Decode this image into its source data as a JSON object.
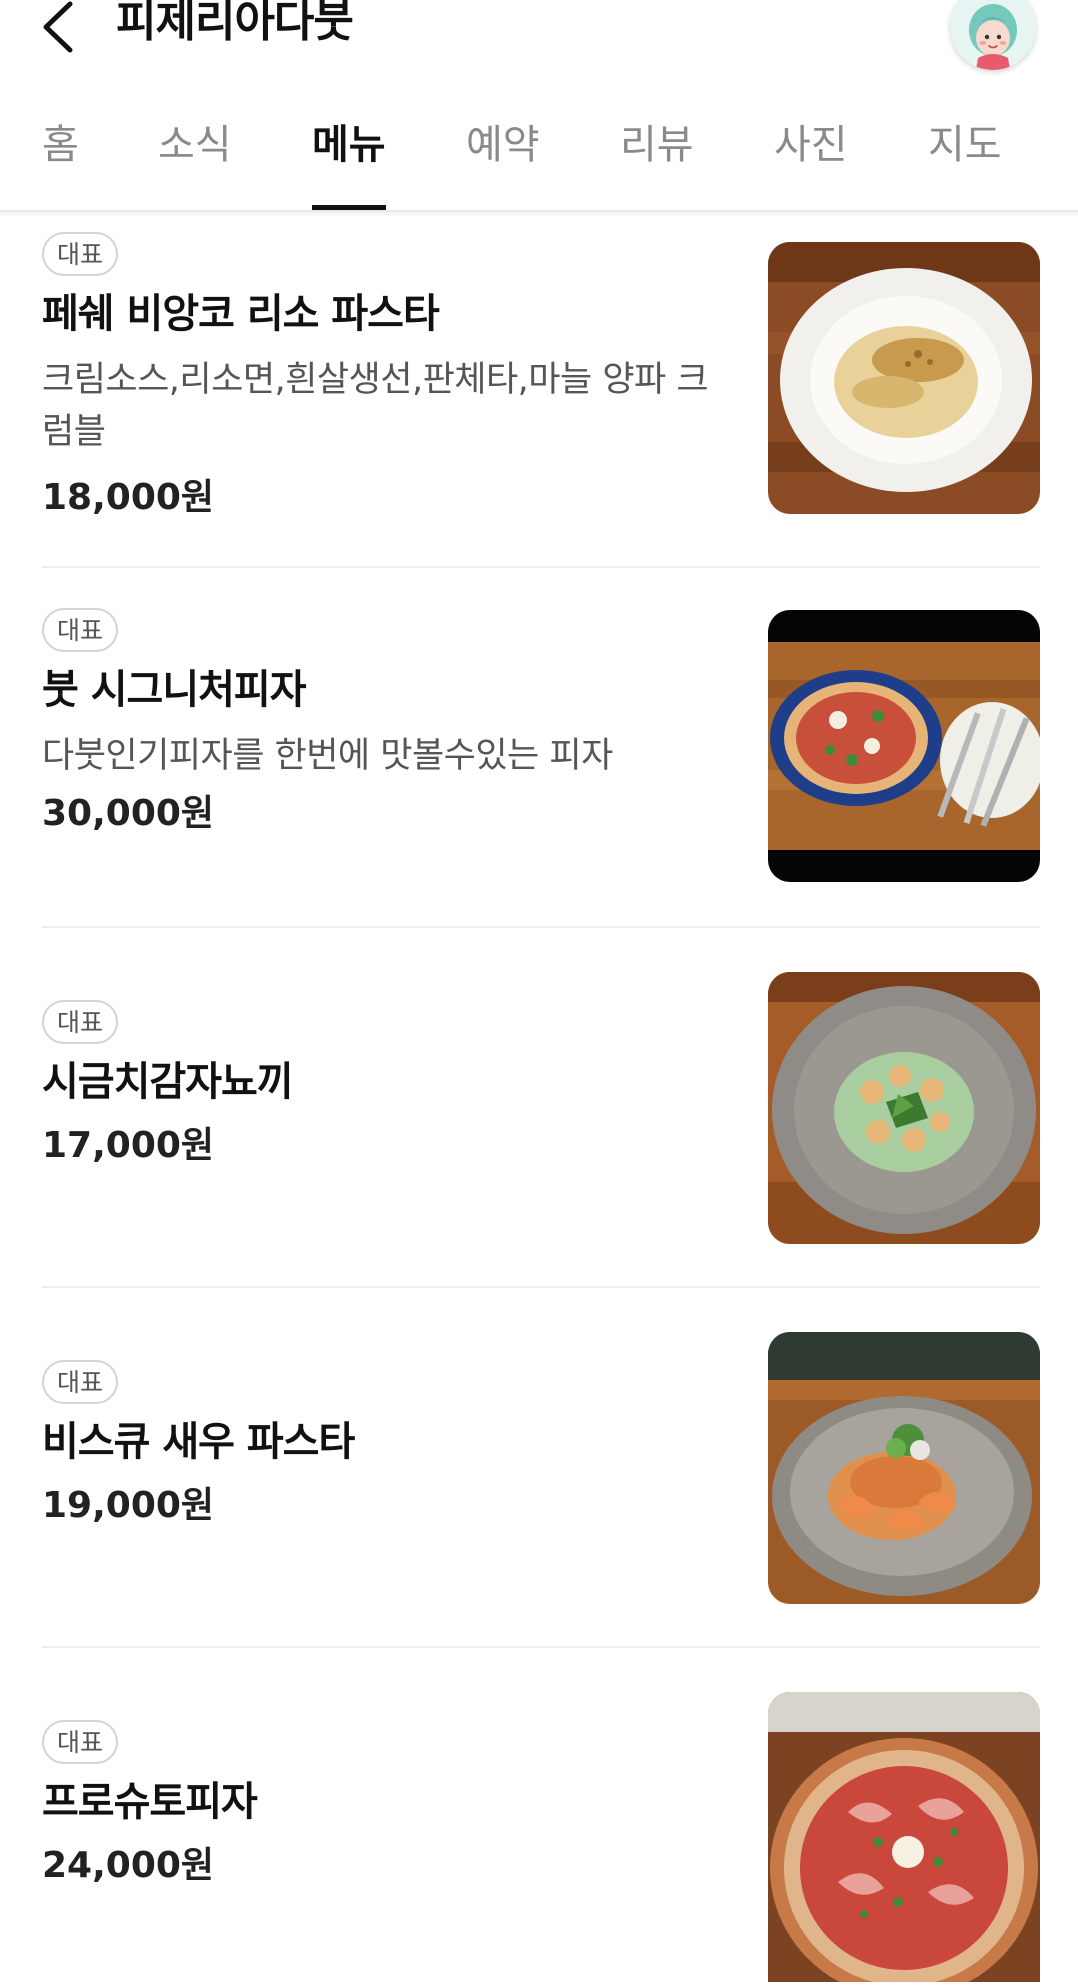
{
  "header": {
    "title": "피제리아다붓",
    "back_icon": "chevron-left-icon",
    "avatar_icon": "profile-avatar-icon"
  },
  "tabs": [
    {
      "label": "홈",
      "active": false
    },
    {
      "label": "소식",
      "active": false
    },
    {
      "label": "메뉴",
      "active": true
    },
    {
      "label": "예약",
      "active": false
    },
    {
      "label": "리뷰",
      "active": false
    },
    {
      "label": "사진",
      "active": false
    },
    {
      "label": "지도",
      "active": false
    }
  ],
  "menu": [
    {
      "badge": "대표",
      "name": "페쉐 비앙코 리소 파스타",
      "description": "크림소스,리소면,흰살생선,판체타,마늘 양파 크럼블",
      "price": "18,000원",
      "photo": "risotto-pasta-photo"
    },
    {
      "badge": "대표",
      "name": "붓 시그니처피자",
      "description": "다붓인기피자를 한번에 맛볼수있는 피자",
      "price": "30,000원",
      "photo": "signature-pizza-photo"
    },
    {
      "badge": "대표",
      "name": "시금치감자뇨끼",
      "description": "",
      "price": "17,000원",
      "photo": "spinach-gnocchi-photo"
    },
    {
      "badge": "대표",
      "name": "비스큐 새우 파스타",
      "description": "",
      "price": "19,000원",
      "photo": "bisque-shrimp-pasta-photo"
    },
    {
      "badge": "대표",
      "name": "프로슈토피자",
      "description": "",
      "price": "24,000원",
      "photo": "prosciutto-pizza-photo"
    }
  ],
  "colors": {
    "text_primary": "#111111",
    "text_secondary": "#555555",
    "tab_inactive": "#8a8a8a",
    "divider": "#eeeeee",
    "badge_border": "#d4d4d4"
  }
}
